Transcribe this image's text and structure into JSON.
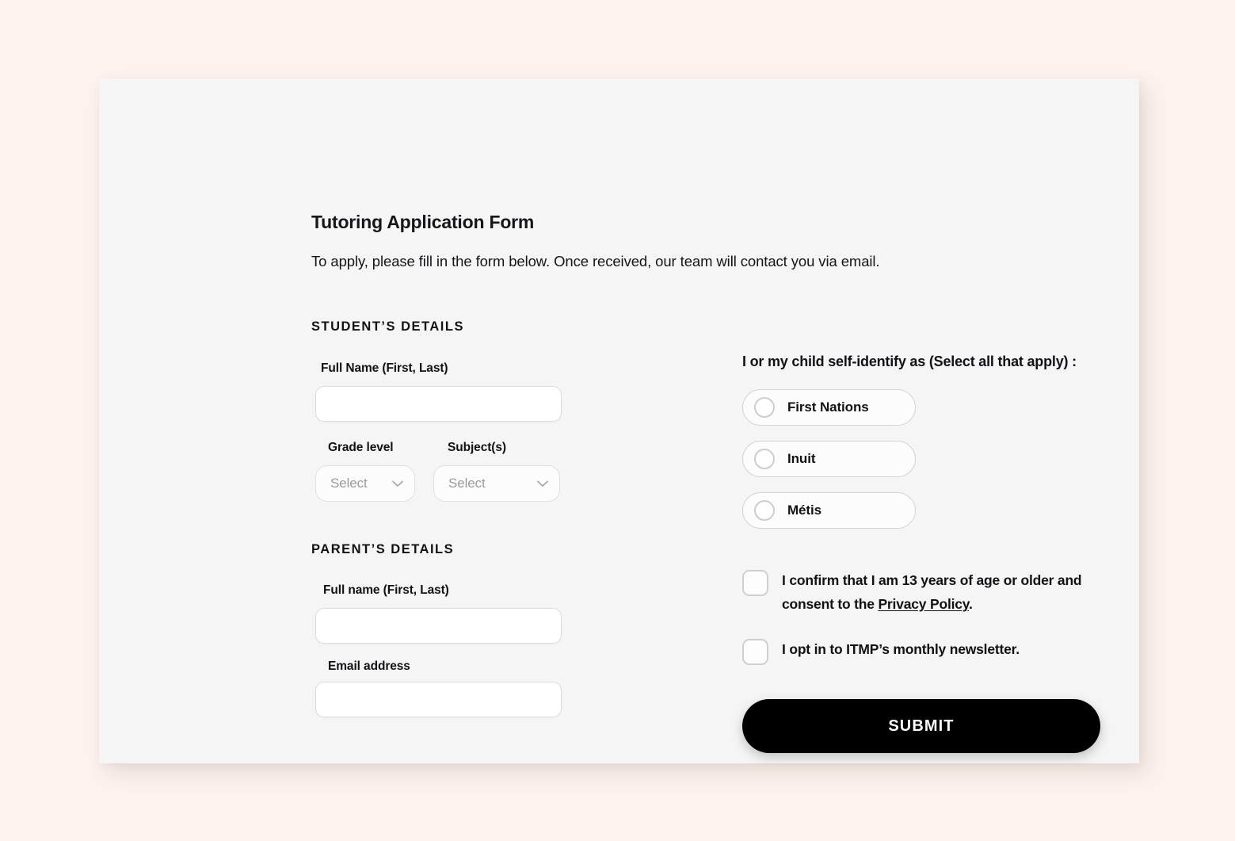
{
  "theme": {
    "page_background": "#fdf2ee",
    "card_background": "#f5f5f6",
    "text_color": "#101216",
    "border_color": "#dcdcdc",
    "placeholder_color": "#9b9b9b",
    "submit_background": "#000000",
    "submit_text_color": "#ffffff"
  },
  "form": {
    "title": "Tutoring Application Form",
    "subtitle": "To apply, please fill in the form below. Once received, our team will contact you via email."
  },
  "student_section": {
    "heading": "STUDENT’S DETAILS",
    "full_name": {
      "label": "Full Name (First, Last)",
      "value": "",
      "placeholder": ""
    },
    "grade_level": {
      "label": "Grade level",
      "value": "Select",
      "icon": "chevron-down-icon"
    },
    "subjects": {
      "label": "Subject(s)",
      "value": "Select",
      "icon": "chevron-down-icon"
    }
  },
  "parent_section": {
    "heading": "PARENT’S DETAILS",
    "full_name": {
      "label": "Full name (First, Last)",
      "value": "",
      "placeholder": ""
    },
    "email": {
      "label": "Email address",
      "value": "",
      "placeholder": ""
    }
  },
  "identity_section": {
    "question": "I or my child self-identify as (Select all that apply) :",
    "options": [
      {
        "label": "First Nations",
        "selected": false
      },
      {
        "label": "Inuit",
        "selected": false
      },
      {
        "label": "Métis",
        "selected": false
      }
    ]
  },
  "consents": [
    {
      "checked": false,
      "text_before": "I confirm that I am 13 years of age or older and consent to the ",
      "link_text": "Privacy Policy",
      "text_after": "."
    },
    {
      "checked": false,
      "text_before": "I opt in to ITMP’s monthly newsletter.",
      "link_text": "",
      "text_after": ""
    }
  ],
  "submit": {
    "label": "SUBMIT"
  }
}
